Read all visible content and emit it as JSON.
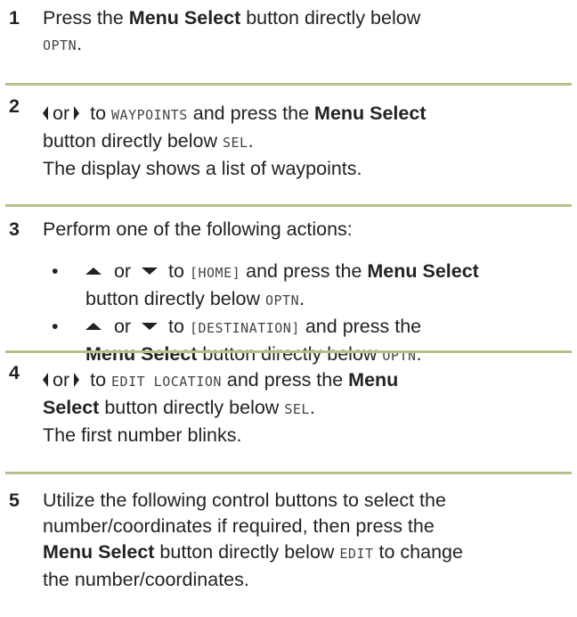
{
  "steps": [
    {
      "number": "1",
      "t1": "Press the ",
      "b1": "Menu Select",
      "t2": " button directly below",
      "code1": "OPTN",
      "t3": "."
    },
    {
      "number": "2",
      "or": "or",
      "t1": " to ",
      "code1": "WAYPOINTS",
      "t2": " and press the ",
      "b1": "Menu Select",
      "t3": "button directly below ",
      "code2": "SEL",
      "t4": ".",
      "result": "The display shows a list of waypoints."
    },
    {
      "number": "3",
      "intro": "Perform one of the following actions:",
      "bullets": [
        {
          "mark": "•",
          "or": " or ",
          "t1": " to ",
          "code1": "[HOME]",
          "t2": " and press the ",
          "b1": "Menu Select",
          "t3": "button directly below ",
          "code2": "OPTN",
          "t4": "."
        },
        {
          "mark": "•",
          "or": " or ",
          "t1": " to ",
          "code1": "[DESTINATION]",
          "t2": " and press the",
          "b1": "Menu Select",
          "t3": " button directly below ",
          "code2": "OPTN",
          "t4": "."
        }
      ]
    },
    {
      "number": "4",
      "or": "or",
      "t1": " to ",
      "code1": "EDIT LOCATION",
      "t2": " and press the ",
      "b1": "Menu",
      "b2": "Select",
      "t3": " button directly below ",
      "code2": "SEL",
      "t4": ".",
      "result": "The first number blinks."
    },
    {
      "number": "5",
      "l1": "Utilize the following control buttons to select the",
      "l2": "number/coordinates if required, then press the",
      "b1": "Menu Select",
      "t1": " button directly below ",
      "code1": "EDIT",
      "t2": " to change",
      "l4": "the number/coordinates."
    }
  ]
}
